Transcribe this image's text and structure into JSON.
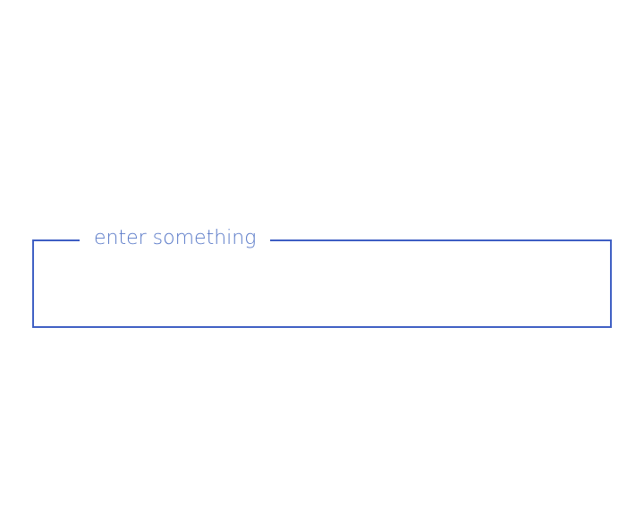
{
  "field": {
    "label": "enter something",
    "value": "",
    "placeholder": ""
  },
  "colors": {
    "outline": "#3f5fc4",
    "label": "#5a7ac8",
    "background": "#ffffff"
  }
}
